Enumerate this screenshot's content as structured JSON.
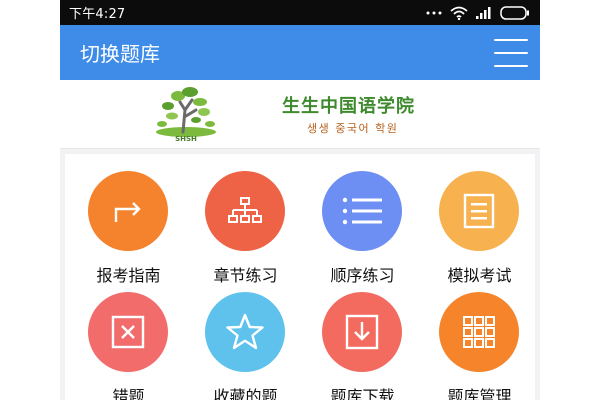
{
  "status_bar": {
    "time": "下午4:27",
    "icons": [
      "more-dots-icon",
      "wifi-icon",
      "signal-icon",
      "battery-icon"
    ]
  },
  "app_bar": {
    "title": "切换题库",
    "menu_icon": "hamburger-menu-icon",
    "color": "#3f8ce8"
  },
  "banner": {
    "logo_text": "SHSH",
    "school_name": "生生中国语学院",
    "school_name_korean": "생생 중국어 학원"
  },
  "grid": {
    "items": [
      {
        "label": "报考指南",
        "icon": "arrow-turn-icon",
        "color": "#f5822c"
      },
      {
        "label": "章节练习",
        "icon": "sitemap-icon",
        "color": "#ee6245"
      },
      {
        "label": "顺序练习",
        "icon": "list-icon",
        "color": "#6d8ef2"
      },
      {
        "label": "模拟考试",
        "icon": "document-icon",
        "color": "#f7b14f"
      },
      {
        "label": "错题",
        "icon": "close-box-icon",
        "color": "#f26c6c"
      },
      {
        "label": "收藏的题",
        "icon": "star-icon",
        "color": "#5ec2ec"
      },
      {
        "label": "题库下载",
        "icon": "download-icon",
        "color": "#f36b5f"
      },
      {
        "label": "题库管理",
        "icon": "grid-icon",
        "color": "#f5842b"
      }
    ]
  }
}
